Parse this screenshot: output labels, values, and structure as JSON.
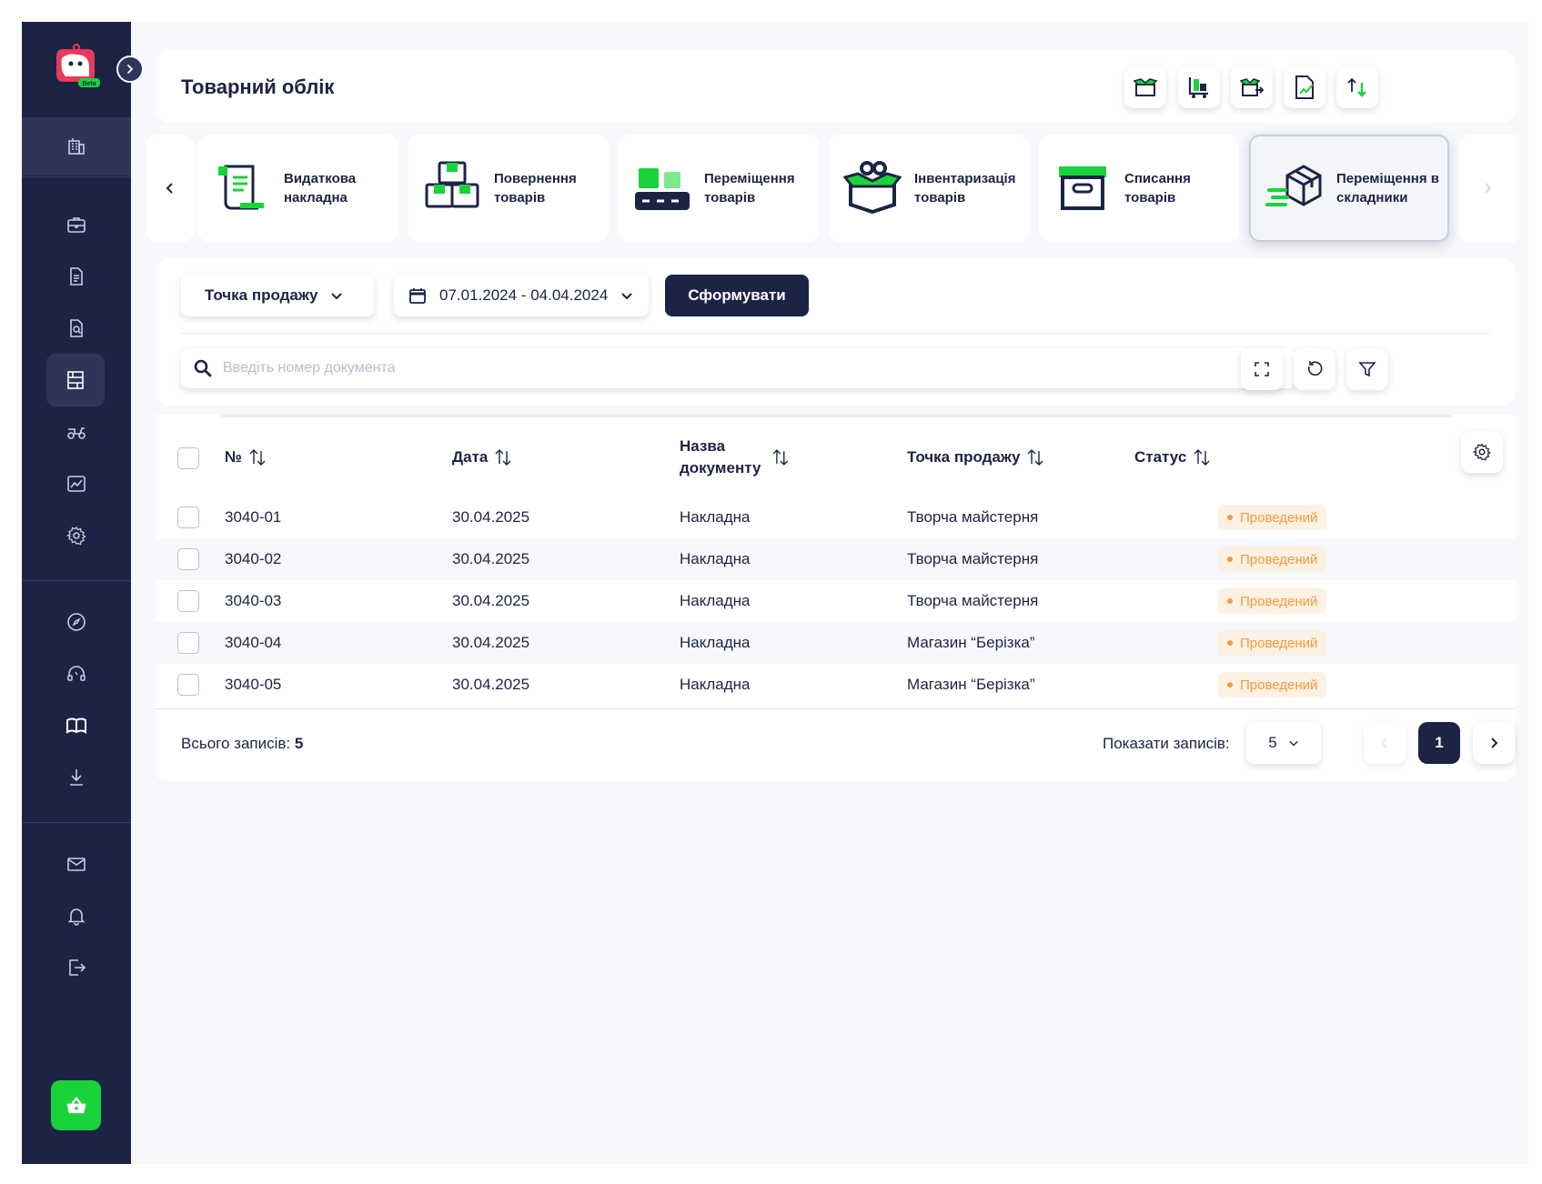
{
  "header": {
    "title": "Товарний облік"
  },
  "tiles": [
    {
      "label": "Видаткова накладна",
      "icon": "invoice-icon"
    },
    {
      "label": "Повернення товарів",
      "icon": "return-goods-icon"
    },
    {
      "label": "Переміщення товарів",
      "icon": "move-goods-icon"
    },
    {
      "label": "Інвентаризація товарів",
      "icon": "inventory-icon"
    },
    {
      "label": "Списання товарів",
      "icon": "write-off-icon"
    },
    {
      "label": "Переміщення в складники",
      "icon": "move-to-components-icon",
      "selected": true
    }
  ],
  "filters": {
    "point_of_sale": "Точка продажу",
    "date_range": "07.01.2024 - 04.04.2024",
    "submit_label": "Сформувати",
    "search_placeholder": "Введіть номер документа"
  },
  "table": {
    "columns": [
      "№",
      "Дата",
      "Назва документу",
      "Точка продажу",
      "Статус"
    ],
    "rows": [
      {
        "number": "3040-01",
        "date": "30.04.2025",
        "doc_name": "Накладна",
        "point": "Творча майстерня",
        "status": "Проведений"
      },
      {
        "number": "3040-02",
        "date": "30.04.2025",
        "doc_name": "Накладна",
        "point": "Творча майстерня",
        "status": "Проведений"
      },
      {
        "number": "3040-03",
        "date": "30.04.2025",
        "doc_name": "Накладна",
        "point": "Творча майстерня",
        "status": "Проведений"
      },
      {
        "number": "3040-04",
        "date": "30.04.2025",
        "doc_name": "Накладна",
        "point": "Магазин “Берізка”",
        "status": "Проведений"
      },
      {
        "number": "3040-05",
        "date": "30.04.2025",
        "doc_name": "Накладна",
        "point": "Магазин “Берізка”",
        "status": "Проведений"
      }
    ]
  },
  "footer": {
    "total_label": "Всього записів:",
    "total_value": "5",
    "show_label": "Показати записів:",
    "per_page": "5",
    "current_page": "1"
  },
  "logo": {
    "badge": "Beta"
  },
  "colors": {
    "sidebar": "#1c2445",
    "accent_green": "#1ad33a",
    "status_orange": "#f39a3e",
    "background": "#f7f8fc"
  }
}
